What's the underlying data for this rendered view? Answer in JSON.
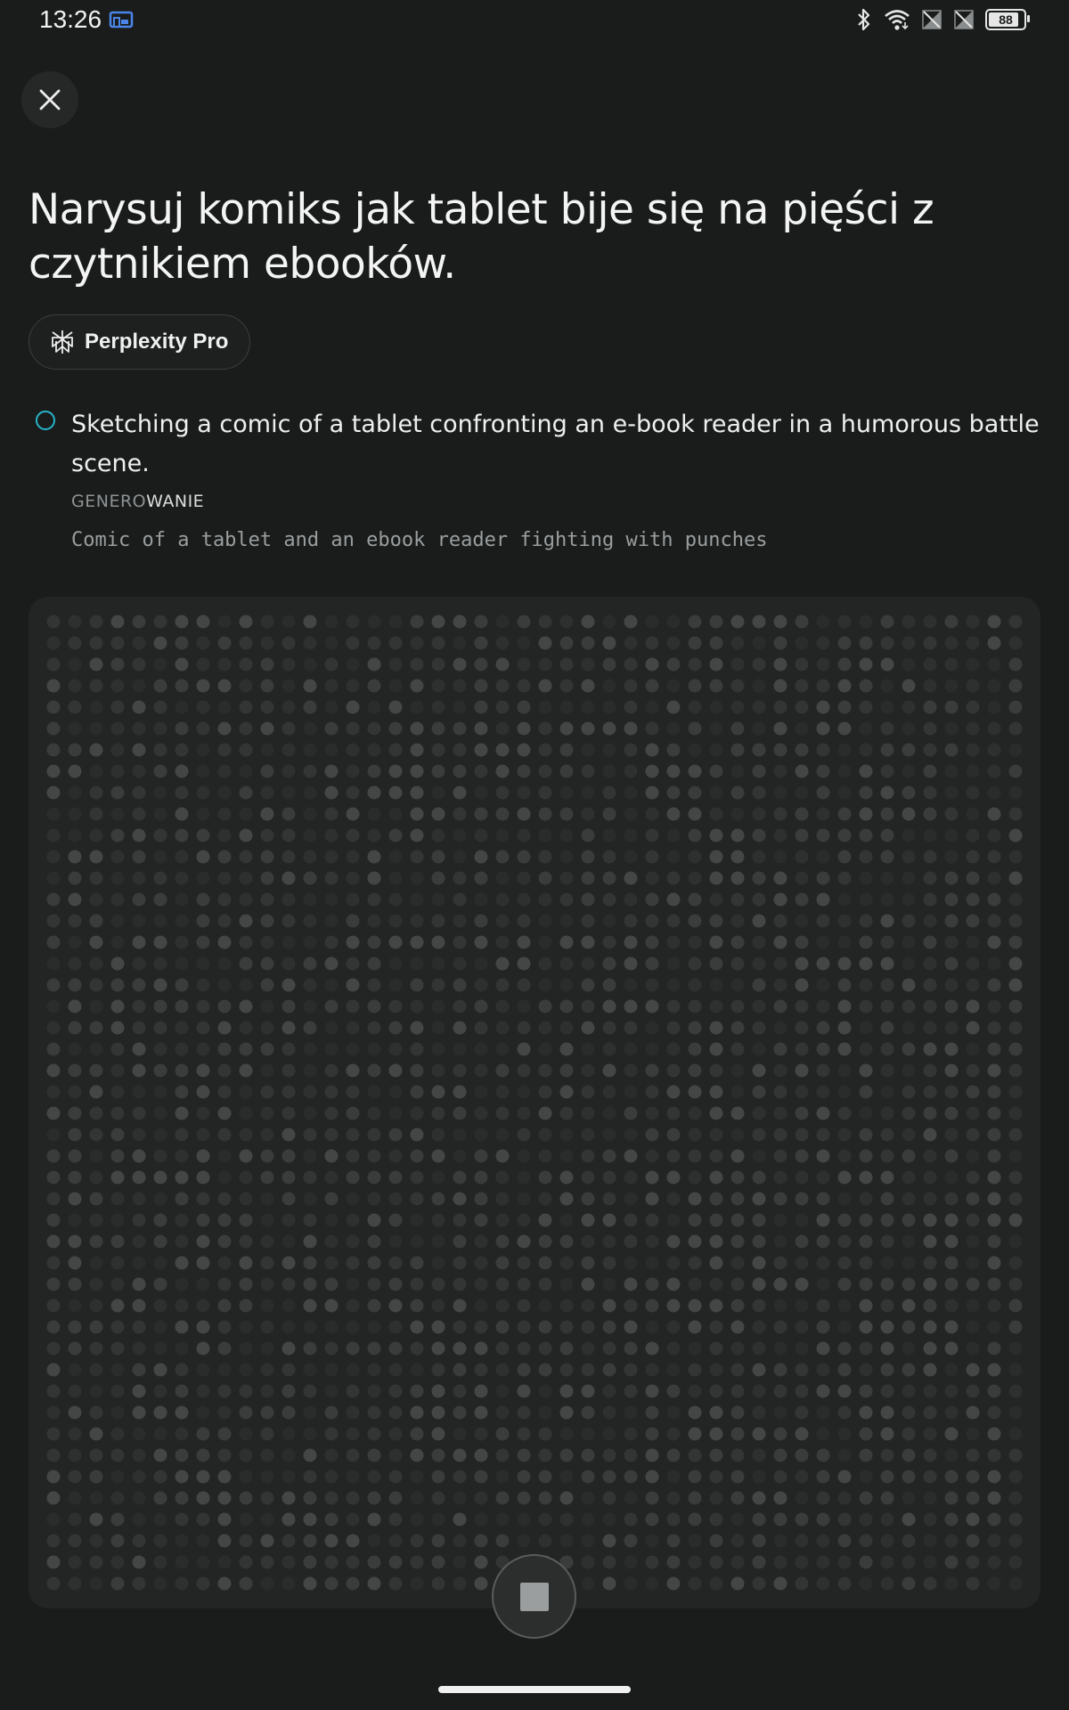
{
  "status_bar": {
    "time": "13:26",
    "battery_level": "88",
    "battery_fraction": 0.88,
    "icons": [
      "cast-icon",
      "bluetooth-icon",
      "wifi-icon",
      "no-sim-icon",
      "no-sim-icon",
      "battery-icon"
    ]
  },
  "close": {
    "icon": "close-icon"
  },
  "query": {
    "title": "Narysuj komiks jak tablet bije się na pięści z czytnikiem ebooków."
  },
  "model_chip": {
    "label": "Perplexity Pro",
    "icon": "perplexity-logo-icon"
  },
  "step": {
    "text": "Sketching a comic of a tablet confronting an e-book reader in a humorous battle scene.",
    "status_dim": "GENERO",
    "status_bright": "WANIE",
    "prompt": "Comic of a tablet and an ebook reader fighting with punches",
    "spinner_color": "#27b3c9"
  },
  "image": {
    "state": "generating"
  },
  "stop": {
    "icon": "stop-icon"
  },
  "colors": {
    "background": "#1a1c1c",
    "panel": "#232525",
    "accent": "#27b3c9"
  }
}
